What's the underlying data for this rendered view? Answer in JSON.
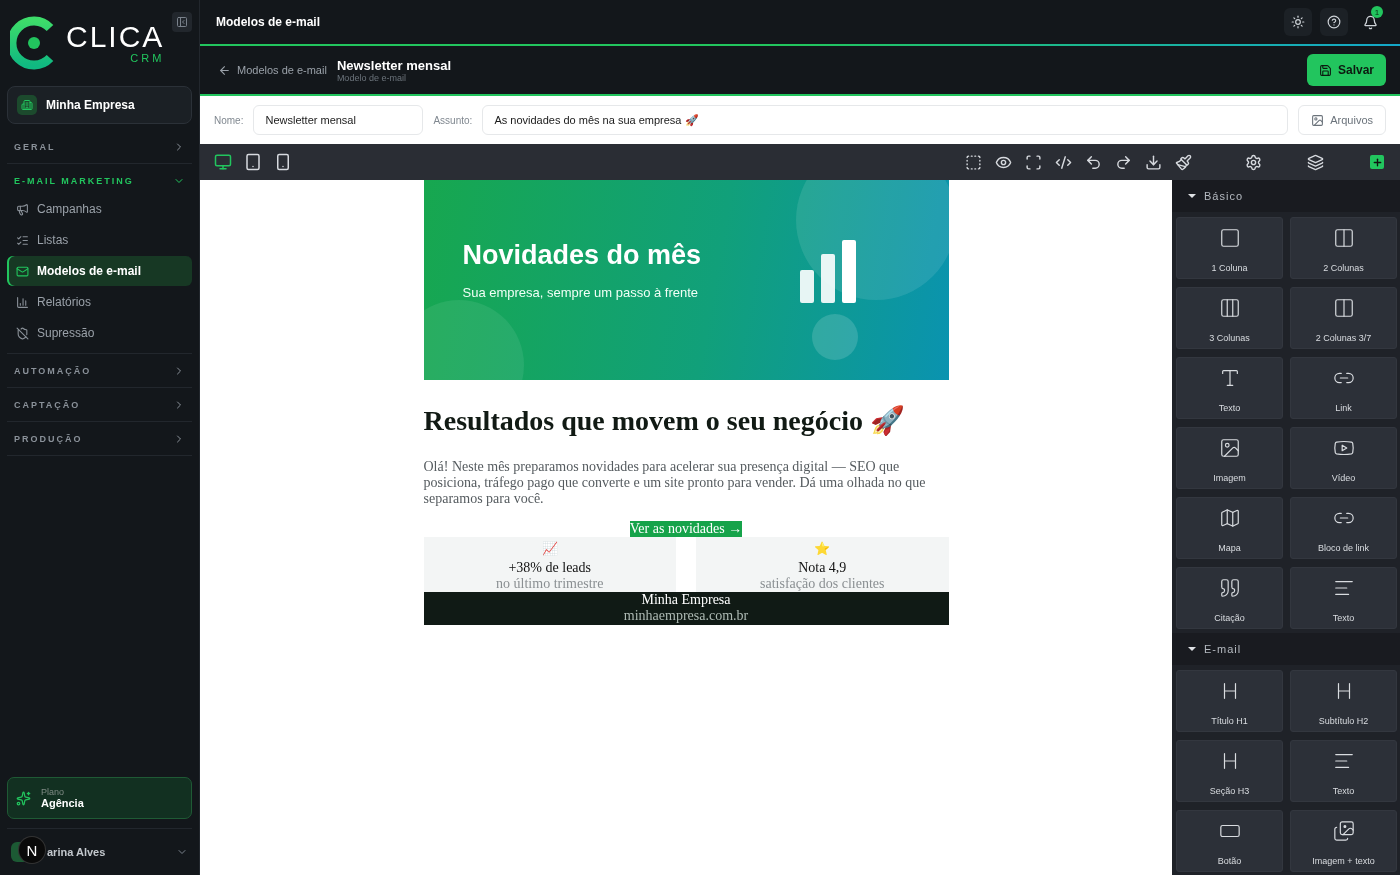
{
  "logo": {
    "name": "CLICA",
    "tag": "CRM"
  },
  "workspace": {
    "name": "Minha Empresa"
  },
  "nav": [
    {
      "label": "GERAL",
      "expanded": false
    },
    {
      "label": "E-MAIL MARKETING",
      "expanded": true,
      "items": [
        {
          "label": "Campanhas",
          "selected": false
        },
        {
          "label": "Listas",
          "selected": false
        },
        {
          "label": "Modelos de e-mail",
          "selected": true
        },
        {
          "label": "Relatórios",
          "selected": false
        },
        {
          "label": "Supressão",
          "selected": false
        }
      ]
    },
    {
      "label": "AUTOMAÇÃO",
      "expanded": false
    },
    {
      "label": "CAPTAÇÃO",
      "expanded": false
    },
    {
      "label": "PRODUÇÃO",
      "expanded": false
    }
  ],
  "plan": {
    "label": "Plano",
    "name": "Agência"
  },
  "user": {
    "name": "arina Alves"
  },
  "dev_badge": "N",
  "topbar": {
    "title": "Modelos de e-mail",
    "notifications": "1"
  },
  "header": {
    "back": "Modelos de e-mail",
    "title": "Newsletter mensal",
    "subtitle": "Modelo de e-mail",
    "save": "Salvar"
  },
  "fields": {
    "name_label": "Nome:",
    "name_value": "Newsletter mensal",
    "subject_label": "Assunto:",
    "subject_value": "As novidades do mês na sua empresa 🚀",
    "files": "Arquivos"
  },
  "devices": [
    {
      "kind": "desktop",
      "selected": true
    },
    {
      "kind": "tablet",
      "selected": false
    },
    {
      "kind": "mobile",
      "selected": false
    }
  ],
  "email": {
    "hero_title": "Novidades do mês",
    "hero_subtitle": "Sua empresa, sempre um passo à frente",
    "heading": "Resultados que movem o seu negócio 🚀",
    "body": "Olá! Neste mês preparamos novidades para acelerar sua presença digital — SEO que posiciona, tráfego pago que converte e um site pronto para vender. Dá uma olhada no que separamos para você.",
    "cta": "Ver as novidades →",
    "stats": [
      {
        "emoji": "📈",
        "value": "+38% de leads",
        "caption": "no último trimestre"
      },
      {
        "emoji": "⭐",
        "value": "Nota 4,9",
        "caption": "satisfação dos clientes"
      }
    ],
    "footer_name": "Minha Empresa",
    "footer_url": "minhaempresa.com.br"
  },
  "blocks": [
    {
      "title": "Básico",
      "items": [
        {
          "kind": "col1",
          "label": "1 Coluna"
        },
        {
          "kind": "col2",
          "label": "2 Colunas"
        },
        {
          "kind": "col3",
          "label": "3 Colunas"
        },
        {
          "kind": "col37",
          "label": "2 Colunas 3/7"
        },
        {
          "kind": "text",
          "label": "Texto"
        },
        {
          "kind": "link",
          "label": "Link"
        },
        {
          "kind": "image",
          "label": "Imagem"
        },
        {
          "kind": "video",
          "label": "Vídeo"
        },
        {
          "kind": "map",
          "label": "Mapa"
        },
        {
          "kind": "link",
          "label": "Bloco de link"
        },
        {
          "kind": "quote",
          "label": "Citação"
        },
        {
          "kind": "lines",
          "label": "Texto"
        }
      ]
    },
    {
      "title": "E-mail",
      "items": [
        {
          "kind": "heading",
          "label": "Título H1"
        },
        {
          "kind": "heading",
          "label": "Subtítulo H2"
        },
        {
          "kind": "heading",
          "label": "Seção H3"
        },
        {
          "kind": "lines",
          "label": "Texto"
        },
        {
          "kind": "button",
          "label": "Botão"
        },
        {
          "kind": "imagetext",
          "label": "Imagem + texto"
        }
      ]
    }
  ]
}
